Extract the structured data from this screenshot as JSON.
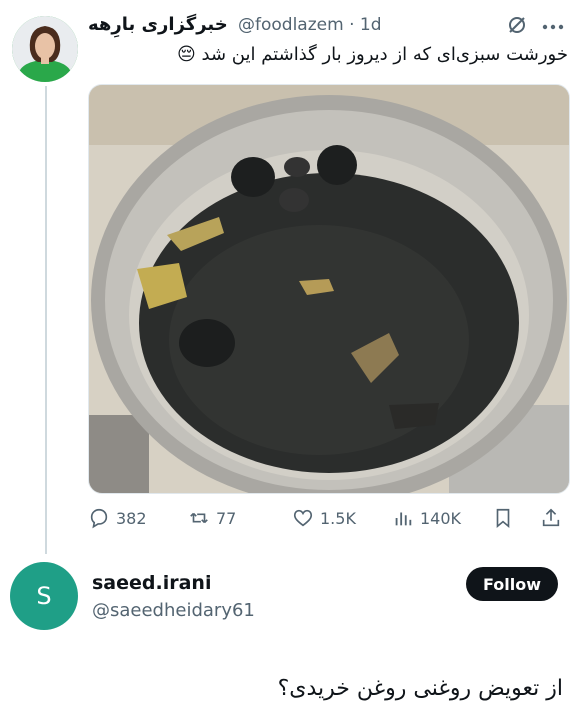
{
  "tweet": {
    "author_name": "خبرگزاری بارِهه",
    "handle": "@foodlazem",
    "separator": "·",
    "time": "1d",
    "text": "خورشت سبزی‌ای که از دیروز بار گذاشتم این شد 😔",
    "media_description": "photo of a steel pot containing dark, burnt stew with dried limes",
    "stats": {
      "replies": "382",
      "retweets": "77",
      "likes": "1.5K",
      "views": "140K"
    }
  },
  "reply": {
    "avatar_letter": "S",
    "name": "saeed.irani",
    "handle": "@saeedheidary61",
    "follow_label": "Follow",
    "text": "از تعویض روغنی روغن خریدی؟"
  },
  "colors": {
    "text": "#0f1419",
    "secondary": "#536471",
    "reply_avatar_bg": "#1f9f87",
    "follow_bg": "#0f1419"
  },
  "icons": [
    "nosign-icon",
    "more-icon",
    "reply-icon",
    "retweet-icon",
    "like-icon",
    "views-icon",
    "bookmark-icon",
    "share-icon"
  ]
}
